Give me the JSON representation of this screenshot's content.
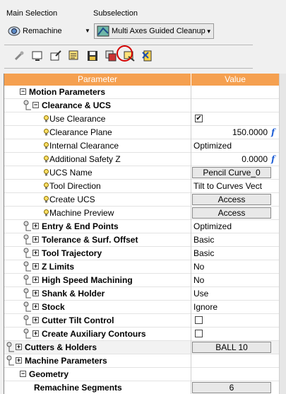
{
  "selection": {
    "main_label": "Main Selection",
    "sub_label": "Subselection",
    "main_value": "Remachine",
    "sub_value": "Multi Axes Guided Cleanup"
  },
  "toolbar": {
    "icons": [
      "link-icon",
      "display-icon",
      "export-icon",
      "tool-list-icon",
      "save-icon",
      "copy-params-icon",
      "highlight-params-icon",
      "close-icon"
    ]
  },
  "grid": {
    "header_param": "Parameter",
    "header_value": "Value",
    "rows": [
      {
        "name": "Motion Parameters",
        "value": "",
        "level": 0
      },
      {
        "name": "Clearance & UCS",
        "value": "",
        "level": 1
      },
      {
        "name": "Use Clearance",
        "value": "",
        "check": true
      },
      {
        "name": "Clearance Plane",
        "value": "150.0000",
        "fx": "f"
      },
      {
        "name": "Internal Clearance",
        "value": "Optimized"
      },
      {
        "name": "Additional Safety Z",
        "value": "0.0000",
        "fx": "f"
      },
      {
        "name": "UCS Name",
        "value": "Pencil Curve_0",
        "button": true
      },
      {
        "name": "Tool Direction",
        "value": "Tilt to Curves Vect"
      },
      {
        "name": "Create UCS",
        "value": "Access",
        "button": true
      },
      {
        "name": "Machine Preview",
        "value": "Access",
        "button": true
      },
      {
        "name": "Entry & End Points",
        "value": "Optimized"
      },
      {
        "name": "Tolerance & Surf. Offset",
        "value": "Basic"
      },
      {
        "name": "Tool Trajectory",
        "value": "Basic"
      },
      {
        "name": "Z Limits",
        "value": "No"
      },
      {
        "name": "High Speed Machining",
        "value": "No"
      },
      {
        "name": "Shank & Holder",
        "value": "Use"
      },
      {
        "name": "Stock",
        "value": "Ignore"
      },
      {
        "name": "Cutter Tilt Control",
        "value": "",
        "check": false
      },
      {
        "name": "Create Auxiliary Contours",
        "value": "",
        "check": false
      },
      {
        "name": "Cutters & Holders",
        "value": "BALL 10",
        "button": true
      },
      {
        "name": "Machine Parameters",
        "value": ""
      },
      {
        "name": "Geometry",
        "value": ""
      },
      {
        "name": "Remachine Segments",
        "value": "6",
        "button": true
      }
    ]
  },
  "colors": {
    "header": "#f5a050",
    "link_fx": "#1f5fd6",
    "highlight_circle": "#d40000"
  }
}
